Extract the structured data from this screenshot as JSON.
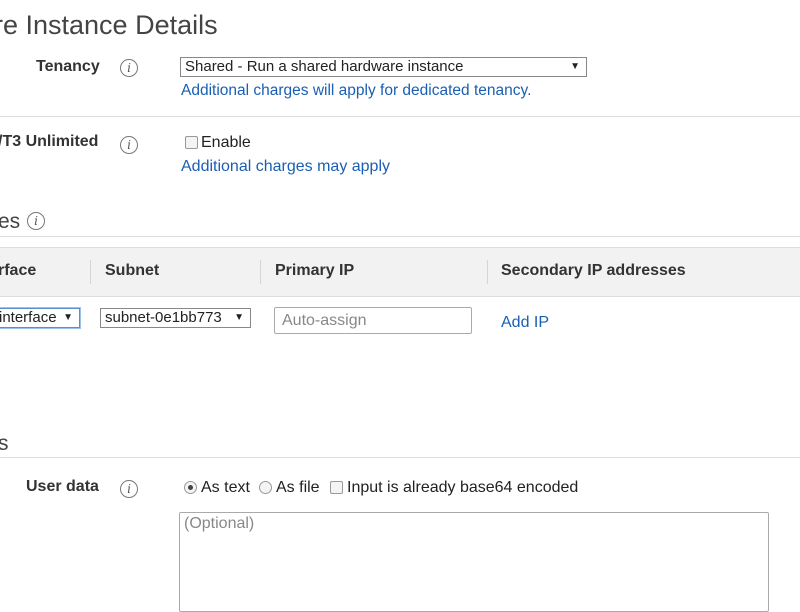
{
  "header": {
    "title": "re Instance Details"
  },
  "tenancy": {
    "label": "Tenancy",
    "info_icon": "info-icon",
    "selected": "Shared - Run a shared hardware instance",
    "note": "Additional charges will apply for dedicated tenancy."
  },
  "t2t3": {
    "label": "/T3 Unlimited",
    "checkbox_label": "Enable",
    "checked": false,
    "note": "Additional charges may apply"
  },
  "network_section": {
    "title_fragment": "es"
  },
  "network_table": {
    "columns": [
      "rface",
      "Subnet",
      "Primary IP",
      "Secondary IP addresses"
    ],
    "row": {
      "interface_value": "interface",
      "subnet_value": "subnet-0e1bb773",
      "primary_ip_placeholder": "Auto-assign",
      "add_ip_label": "Add IP"
    }
  },
  "advanced_section": {
    "title_fragment": "s"
  },
  "user_data": {
    "label": "User data",
    "options": [
      "As text",
      "As file"
    ],
    "selected_option": "As text",
    "base64_label": "Input is already base64 encoded",
    "base64_checked": false,
    "textarea_placeholder": "(Optional)"
  },
  "colors": {
    "link": "#1a5fb4",
    "table_header_bg": "#f2f2f2",
    "divider": "#dddddd"
  }
}
